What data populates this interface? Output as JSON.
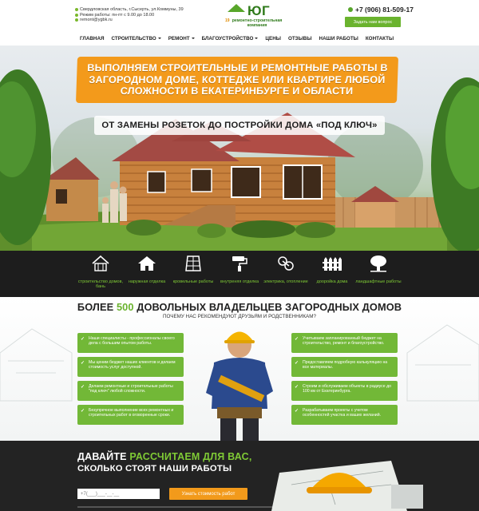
{
  "header": {
    "address_lines": [
      "Свердловская область, г.Сысерть, ул.Коммуны, 39",
      "Режим работы: пн-пт с 9.00 до 18.00",
      "remont@ygbk.ru"
    ],
    "logo_text": "ЮГ",
    "logo_number": "19",
    "logo_subtitle": "ремонтно-строительная компания",
    "phone": "+7 (906) 81-509-17",
    "ask_button": "Задать нам вопрос"
  },
  "nav": {
    "items": [
      {
        "label": "ГЛАВНАЯ",
        "dropdown": false
      },
      {
        "label": "СТРОИТЕЛЬСТВО",
        "dropdown": true
      },
      {
        "label": "РЕМОНТ",
        "dropdown": true
      },
      {
        "label": "БЛАГОУСТРОЙСТВО",
        "dropdown": true
      },
      {
        "label": "ЦЕНЫ",
        "dropdown": false
      },
      {
        "label": "ОТЗЫВЫ",
        "dropdown": false
      },
      {
        "label": "НАШИ РАБОТЫ",
        "dropdown": false
      },
      {
        "label": "КОНТАКТЫ",
        "dropdown": false
      }
    ]
  },
  "hero": {
    "headline": "ВЫПОЛНЯЕМ СТРОИТЕЛЬНЫЕ И РЕМОНТНЫЕ РАБОТЫ В ЗАГОРОДНОМ ДОМЕ, КОТТЕДЖЕ ИЛИ КВАРТИРЕ ЛЮБОЙ СЛОЖНОСТИ В ЕКАТЕРИНБУРГЕ И ОБЛАСТИ",
    "subheadline": "ОТ ЗАМЕНЫ РОЗЕТОК ДО ПОСТРОЙКИ ДОМА «ПОД КЛЮЧ»",
    "accent_color": "#f39a1b"
  },
  "services": [
    {
      "label": "строительство домов, бань",
      "icon": "house-frame-icon"
    },
    {
      "label": "наружная отделка",
      "icon": "house-facade-icon"
    },
    {
      "label": "кровельные работы",
      "icon": "roof-tiles-icon"
    },
    {
      "label": "внутреняя отделка",
      "icon": "paint-roller-icon"
    },
    {
      "label": "электрика, отопление",
      "icon": "electric-plug-icon"
    },
    {
      "label": "дооройка дома",
      "icon": "fence-icon"
    },
    {
      "label": "ландшафтные работы",
      "icon": "tree-icon"
    }
  ],
  "why": {
    "title_prefix": "БОЛЕЕ ",
    "title_number": "500",
    "title_suffix": " ДОВОЛЬНЫХ ВЛАДЕЛЬЦЕВ ЗАГОРОДНЫХ ДОМОВ",
    "subtitle": "ПОЧЕМУ НАС РЕКОМЕНДУЮТ ДРУЗЬЯМ И РОДСТВЕННИКАМ?",
    "left_cards": [
      "Наши специалисты - профессионалы своего дела с большим опытом работы.",
      "Мы ценим бюджет наших клиентов и делаем стоимость услуг доступной.",
      "Делаем ремонтные и строительные работы \"под ключ\" любой сложности.",
      "Безупречное выполнение всех ремонтных и строительных работ в оговоренные сроки."
    ],
    "right_cards": [
      "Учитываем запланированный бюджет на строительство, ремонт и благоустройство.",
      "Предоставляем подробную калькуляцию на все материалы.",
      "Строим и обслуживаем объекты в радиусе до 100 км от Екатеринбурга.",
      "Разрабатываем проекты с учетом особенностей участка и ваших желаний."
    ],
    "card_color": "#72b837"
  },
  "calc": {
    "title_prefix": "ДАВАЙТЕ ",
    "title_accent": "РАССЧИТАЕМ ДЛЯ ВАС,",
    "title_line2": "СКОЛЬКО СТОЯТ НАШИ РАБОТЫ",
    "input_value": "+7(___)___-__-__",
    "button": "Узнать стоимость работ"
  }
}
